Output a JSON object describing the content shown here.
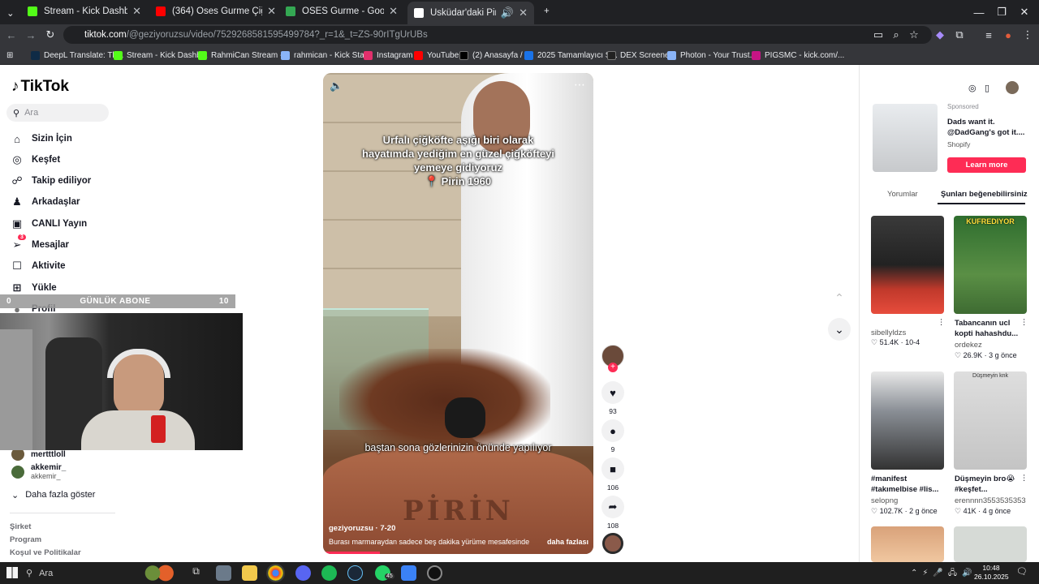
{
  "tabs": [
    {
      "title": "Stream - Kick Dashboard",
      "color": "#53fc18"
    },
    {
      "title": "(364) Oses Gurme Çiğköfte, Ka",
      "color": "#ff0000"
    },
    {
      "title": "OSES Gurme - Google Haritalar",
      "color": "#34a853"
    },
    {
      "title": "Üsküdar'daki Pirin 1960'da",
      "color": "#ffffff"
    }
  ],
  "address": {
    "host": "tiktok.com",
    "path": "/@geziyoruzsu/video/7529268581595499784?_r=1&_t=ZS-90rITgUrUBs"
  },
  "bookmarks": [
    {
      "label": "DeepL Translate: Th...",
      "color": "#0f2b46"
    },
    {
      "label": "Stream - Kick Dashb...",
      "color": "#53fc18"
    },
    {
      "label": "RahmiCan Stream -...",
      "color": "#53fc18"
    },
    {
      "label": "rahmican - Kick Stat...",
      "color": "#8ab4f8"
    },
    {
      "label": "Instagram",
      "color": "#e1306c"
    },
    {
      "label": "YouTube",
      "color": "#ff0000"
    },
    {
      "label": "(2) Anasayfa / X",
      "color": "#000000"
    },
    {
      "label": "2025 Tamamlayıcı S...",
      "color": "#1a73e8"
    },
    {
      "label": "DEX Screener",
      "color": "#222222"
    },
    {
      "label": "Photon - Your Trust...",
      "color": "#8ab4f8"
    },
    {
      "label": "PIGSMC - kick.com/...",
      "color": "#c71585"
    }
  ],
  "sidebar": {
    "logo": "TikTok",
    "search_placeholder": "Ara",
    "items": [
      {
        "label": "Sizin İçin",
        "icon": "home-icon",
        "glyph": "⌂"
      },
      {
        "label": "Keşfet",
        "icon": "compass-icon",
        "glyph": "◎"
      },
      {
        "label": "Takip ediliyor",
        "icon": "following-icon",
        "glyph": "☍"
      },
      {
        "label": "Arkadaşlar",
        "icon": "friends-icon",
        "glyph": "♟"
      },
      {
        "label": "CANLI Yayın",
        "icon": "live-icon",
        "glyph": "▣"
      },
      {
        "label": "Mesajlar",
        "icon": "messages-icon",
        "glyph": "➢"
      },
      {
        "label": "Aktivite",
        "icon": "activity-icon",
        "glyph": "☐"
      },
      {
        "label": "Yükle",
        "icon": "upload-icon",
        "glyph": "⊞"
      },
      {
        "label": "Profil",
        "icon": "profile-icon",
        "glyph": "●"
      }
    ],
    "messages_badge": "3",
    "following": [
      {
        "name": "mertttloll",
        "sub": ""
      },
      {
        "name": "akkemir_",
        "sub": "akkemir_"
      }
    ],
    "more": "Daha fazla göster",
    "footer": [
      "Şirket",
      "Program",
      "Koşul ve Politikalar"
    ]
  },
  "overlay": {
    "left": "0",
    "label": "GÜNLÜK ABONE",
    "right": "10"
  },
  "video": {
    "caption_lines": [
      "Urfalı çiğköfte aşığı biri olarak",
      "hayatımda yediğim en güzel çiğköfteyi",
      "yemeye gidiyoruz",
      "📍 Pirin 1960"
    ],
    "subtitle": "baştan sona gözlerinizin önünde yapılıyor",
    "author": "geziyoruzsu · 7-20",
    "description": "Burası marmaraydan sadece beş dakika yürüme mesafesinde",
    "more": "daha fazlası",
    "pot_text": "PİRİN"
  },
  "actions": {
    "likes": "93",
    "comments": "9",
    "saves": "106",
    "shares": "108"
  },
  "right_panel": {
    "ad": {
      "label": "Sponsored",
      "title": "Dads want it. @DadGang's got it....",
      "sponsor": "Shopify",
      "cta": "Learn more"
    },
    "tabs": [
      "Yorumlar",
      "Şunları beğenebilirsiniz"
    ],
    "cards": [
      {
        "title": "",
        "user": "sibellyldzs",
        "likes": "51.4K",
        "date": "10-4",
        "color": "#c0392b"
      },
      {
        "title": "Tabancanın ucl kopti hahashdu...",
        "user": "ordekez",
        "likes": "26.9K",
        "date": "3 g önce",
        "color": "#3d7a3d",
        "overlay": "KUFREDIYOR"
      },
      {
        "title": "#manifest #takımelbise #lis...",
        "user": "selopng",
        "likes": "102.7K",
        "date": "2 g önce",
        "color": "#5b5f66"
      },
      {
        "title": "Düşmeyin bro😭 #keşfet...",
        "user": "erennnn3553535353",
        "likes": "41K",
        "date": "4 g önce",
        "color": "#cfcfcf",
        "overlay": "Düşmeyin knk"
      }
    ]
  },
  "taskbar": {
    "search": "Ara",
    "time": "10:48",
    "date": "26.10.2025",
    "whatsapp_badge": "45"
  }
}
